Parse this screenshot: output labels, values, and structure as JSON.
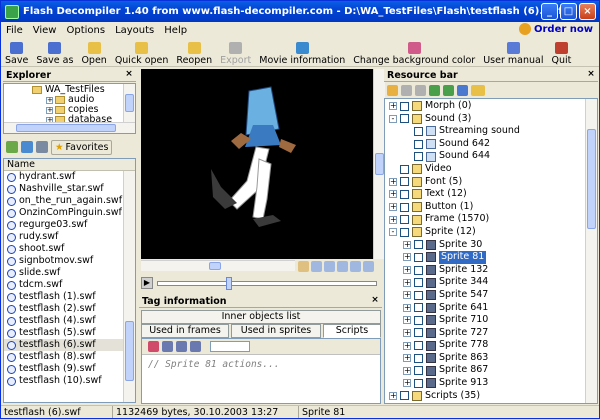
{
  "window": {
    "title": "Flash Decompiler 1.40 from www.flash-decompiler.com - D:\\WA_TestFiles\\Flash\\testflash (6).swf"
  },
  "menu": [
    "File",
    "View",
    "Options",
    "Layouts",
    "Help"
  ],
  "order": {
    "label": "Order now"
  },
  "toolbar": [
    {
      "label": "Save",
      "icon": "save-icon",
      "color": "#4a6fd0",
      "enabled": true
    },
    {
      "label": "Save as",
      "icon": "save-as-icon",
      "color": "#4a6fd0",
      "enabled": true
    },
    {
      "label": "Open",
      "icon": "open-folder-icon",
      "color": "#e8c048",
      "enabled": true
    },
    {
      "label": "Quick open",
      "icon": "quick-open-icon",
      "color": "#e8c048",
      "enabled": true
    },
    {
      "label": "Reopen",
      "icon": "reopen-icon",
      "color": "#e8c048",
      "enabled": true
    },
    {
      "label": "Export",
      "icon": "export-icon",
      "color": "#b0b0b0",
      "enabled": false
    },
    {
      "label": "Movie information",
      "icon": "info-icon",
      "color": "#3a8ad0",
      "enabled": true
    },
    {
      "label": "Change background color",
      "icon": "palette-icon",
      "color": "#d05a8a",
      "enabled": true
    },
    {
      "label": "User manual",
      "icon": "help-icon",
      "color": "#5a7ad8",
      "enabled": true
    },
    {
      "label": "Quit",
      "icon": "quit-icon",
      "color": "#c04030",
      "enabled": true
    }
  ],
  "explorer": {
    "title": "Explorer",
    "tree": [
      {
        "label": "WA_TestFiles",
        "indent": 1
      },
      {
        "label": "audio",
        "indent": 2
      },
      {
        "label": "copies",
        "indent": 2
      },
      {
        "label": "database",
        "indent": 2
      }
    ],
    "favorites_label": "Favorites",
    "column_header": "Name",
    "files": [
      "hydrant.swf",
      "Nashville_star.swf",
      "on_the_run_again.swf",
      "OnzinComPinguin.swf",
      "regurge03.swf",
      "rudy.swf",
      "shoot.swf",
      "signbotmov.swf",
      "slide.swf",
      "tdcm.swf",
      "testflash (1).swf",
      "testflash (2).swf",
      "testflash (4).swf",
      "testflash (5).swf",
      "testflash (6).swf",
      "testflash (8).swf",
      "testflash (9).swf",
      "testflash (10).swf"
    ],
    "selected_file": "testflash (6).swf"
  },
  "tag_info": {
    "title": "Tag information",
    "tabs_top": "Inner objects list",
    "tabs": [
      "Used in frames",
      "Used in sprites",
      "Scripts"
    ],
    "active_tab": "Scripts",
    "script_text": "// Sprite 81 actions..."
  },
  "resource_bar": {
    "title": "Resource bar",
    "items": [
      {
        "label": "Morph (0)",
        "level": 0,
        "expand": "+",
        "icon": "folder"
      },
      {
        "label": "Sound (3)",
        "level": 0,
        "expand": "-",
        "icon": "folder"
      },
      {
        "label": "Streaming sound",
        "level": 1,
        "expand": "",
        "icon": "snd"
      },
      {
        "label": "Sound 642",
        "level": 1,
        "expand": "",
        "icon": "snd"
      },
      {
        "label": "Sound 644",
        "level": 1,
        "expand": "",
        "icon": "snd"
      },
      {
        "label": "Video",
        "level": 0,
        "expand": "",
        "icon": "folder"
      },
      {
        "label": "Font (5)",
        "level": 0,
        "expand": "+",
        "icon": "folder"
      },
      {
        "label": "Text (12)",
        "level": 0,
        "expand": "+",
        "icon": "folder"
      },
      {
        "label": "Button (1)",
        "level": 0,
        "expand": "+",
        "icon": "folder"
      },
      {
        "label": "Frame (1570)",
        "level": 0,
        "expand": "+",
        "icon": "folder"
      },
      {
        "label": "Sprite (12)",
        "level": 0,
        "expand": "-",
        "icon": "folder"
      },
      {
        "label": "Sprite 30",
        "level": 1,
        "expand": "+",
        "icon": "spr"
      },
      {
        "label": "Sprite 81",
        "level": 1,
        "expand": "+",
        "icon": "spr",
        "selected": true
      },
      {
        "label": "Sprite 132",
        "level": 1,
        "expand": "+",
        "icon": "spr"
      },
      {
        "label": "Sprite 344",
        "level": 1,
        "expand": "+",
        "icon": "spr"
      },
      {
        "label": "Sprite 547",
        "level": 1,
        "expand": "+",
        "icon": "spr"
      },
      {
        "label": "Sprite 641",
        "level": 1,
        "expand": "+",
        "icon": "spr"
      },
      {
        "label": "Sprite 710",
        "level": 1,
        "expand": "+",
        "icon": "spr"
      },
      {
        "label": "Sprite 727",
        "level": 1,
        "expand": "+",
        "icon": "spr"
      },
      {
        "label": "Sprite 778",
        "level": 1,
        "expand": "+",
        "icon": "spr"
      },
      {
        "label": "Sprite 863",
        "level": 1,
        "expand": "+",
        "icon": "spr"
      },
      {
        "label": "Sprite 867",
        "level": 1,
        "expand": "+",
        "icon": "spr"
      },
      {
        "label": "Sprite 913",
        "level": 1,
        "expand": "+",
        "icon": "spr"
      },
      {
        "label": "Scripts (35)",
        "level": 0,
        "expand": "+",
        "icon": "folder"
      }
    ]
  },
  "status": {
    "file": "testflash (6).swf",
    "info": "1132469 bytes, 30.10.2003 13:27",
    "selection": "Sprite 81"
  }
}
